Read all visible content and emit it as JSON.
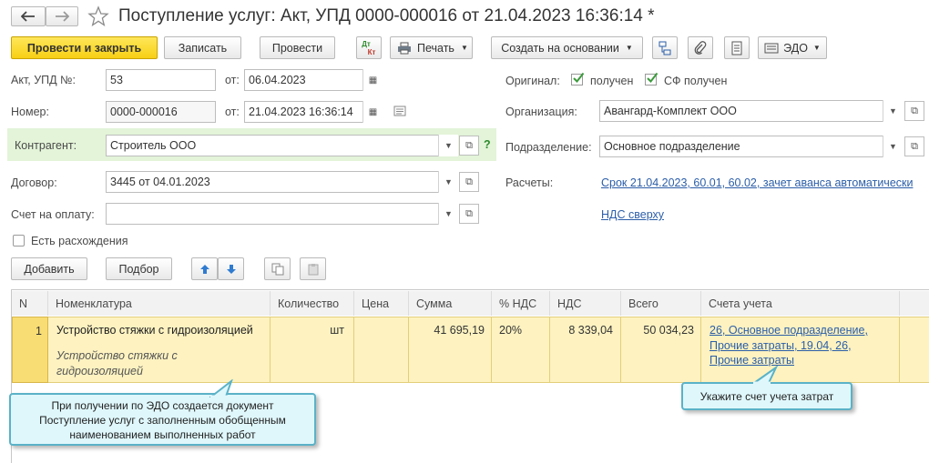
{
  "window": {
    "title": "Поступление услуг: Акт, УПД 0000-000016 от 21.04.2023 16:36:14 *"
  },
  "toolbar": {
    "post_close": "Провести и закрыть",
    "save": "Записать",
    "post": "Провести",
    "dtkt_top": "Дт",
    "dtkt_bottom": "Кт",
    "print": "Печать",
    "create_based": "Создать на основании",
    "edo": "ЭДО"
  },
  "form": {
    "act_label": "Акт, УПД №:",
    "act_number": "53",
    "from_label": "от:",
    "act_date": "06.04.2023",
    "number_label": "Номер:",
    "number": "0000-000016",
    "from_label2": "от:",
    "number_date": "21.04.2023 16:36:14",
    "counterparty_label": "Контрагент:",
    "counterparty": "Строитель ООО",
    "help": "?",
    "contract_label": "Договор:",
    "contract": "3445 от 04.01.2023",
    "invoice_label": "Счет на оплату:",
    "invoice": "",
    "discrepancy_label": "Есть расхождения",
    "original_label": "Оригинал:",
    "received_label": "получен",
    "sf_received_label": "СФ получен",
    "org_label": "Организация:",
    "org": "Авангард-Комплект ООО",
    "dept_label": "Подразделение:",
    "dept": "Основное подразделение",
    "settlements_label": "Расчеты:",
    "settlements_link": "Срок 21.04.2023, 60.01, 60.02, зачет аванса автоматически",
    "vat_link": "НДС сверху"
  },
  "table_toolbar": {
    "add": "Добавить",
    "pick": "Подбор"
  },
  "table": {
    "headers": {
      "n": "N",
      "nomenclature": "Номенклатура",
      "qty": "Количество",
      "price": "Цена",
      "sum": "Сумма",
      "vat_rate": "% НДС",
      "vat": "НДС",
      "total": "Всего",
      "accounts": "Счета учета"
    },
    "row": {
      "n": "1",
      "nomenclature": "Устройство стяжки с гидроизоляцией",
      "content_l1": "Устройство стяжки с",
      "content_l2": "гидроизоляцией",
      "unit": "шт",
      "sum": "41 695,19",
      "vat_rate": "20%",
      "vat": "8 339,04",
      "total": "50 034,23",
      "acc_l1": "26, Основное подразделение,",
      "acc_l2": "Прочие затраты, 19.04, 26,",
      "acc_l3": "Прочие затраты"
    }
  },
  "callouts": {
    "left_l1": "При получении по ЭДО создается документ",
    "left_l2": "Поступление услуг с заполненным обобщенным",
    "left_l3": "наименованием выполненных работ",
    "right": "Укажите счет учета затрат"
  },
  "colors": {
    "primary": "#f7cf14",
    "highlight_row": "#fdf2c0",
    "counterparty_bg": "#e3f4d8",
    "link": "#2b5ea8",
    "check": "#3b9a3b"
  }
}
